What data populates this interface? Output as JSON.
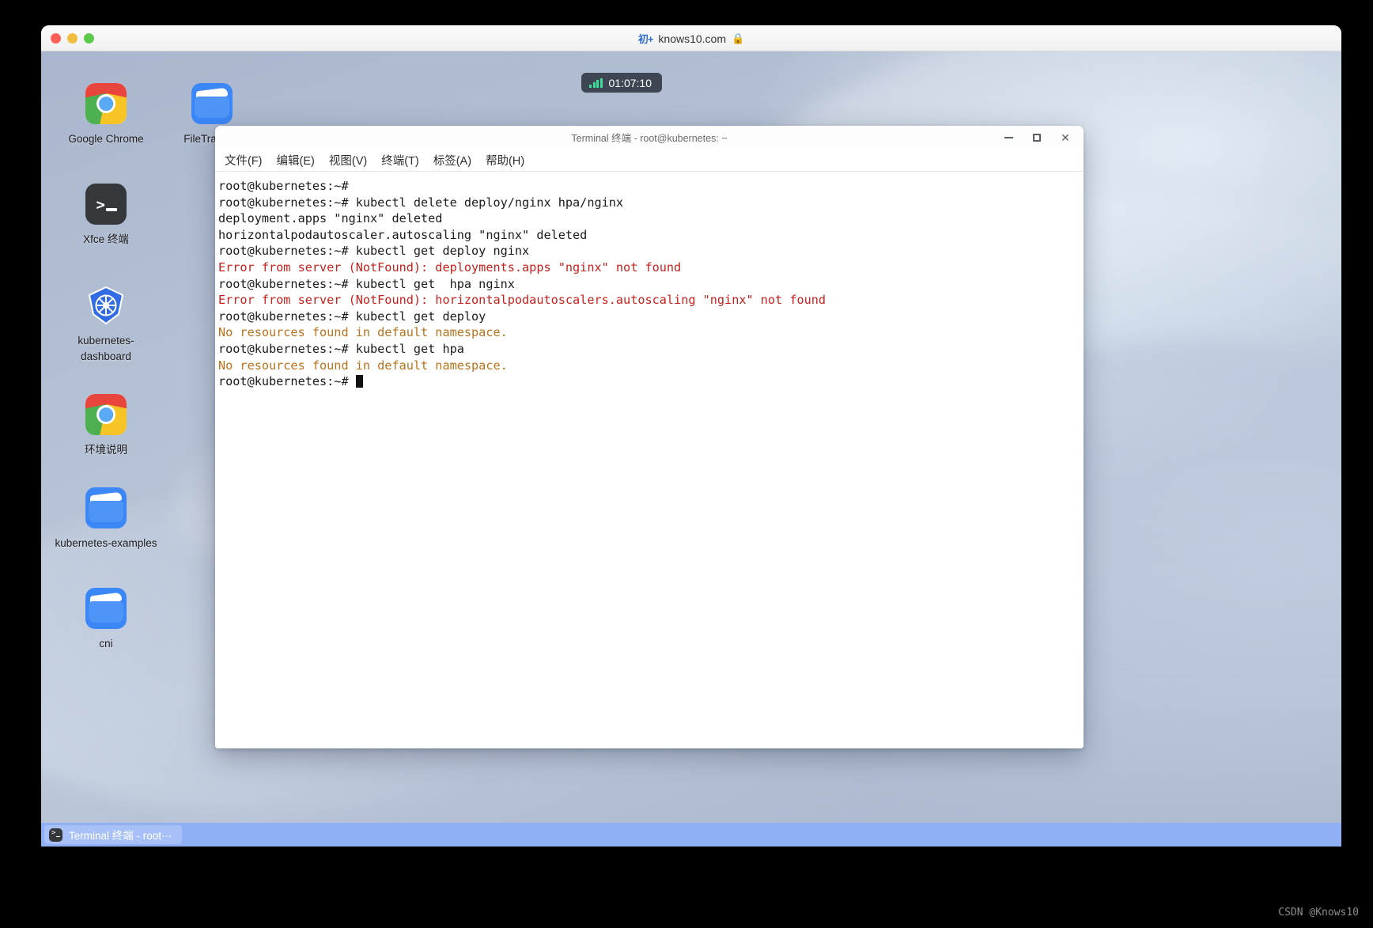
{
  "browser": {
    "address": "knows10.com",
    "lock_icon": "lock-icon",
    "cn_badge": "初+",
    "traffic_lights": [
      "close",
      "minimize",
      "maximize"
    ]
  },
  "status_overlay": {
    "signal_icon": "signal-bars-icon",
    "timer": "01:07:10",
    "signal_color": "#3ddc97"
  },
  "desktop": {
    "icons": [
      {
        "label": "Google Chrome",
        "icon": "google-chrome-icon",
        "col": 0,
        "row": 0
      },
      {
        "label": "FileTransfer",
        "icon": "folder-icon",
        "col": 1,
        "row": 0
      },
      {
        "label": "Xfce 终端",
        "icon": "terminal-icon",
        "col": 0,
        "row": 1
      },
      {
        "label": "kubernetes-dashboard",
        "icon": "kubernetes-icon",
        "col": 0,
        "row": 2
      },
      {
        "label": "环境说明",
        "icon": "google-chrome-icon",
        "col": 0,
        "row": 3
      },
      {
        "label": "kubernetes-examples",
        "icon": "folder-icon",
        "col": 0,
        "row": 4
      },
      {
        "label": "cni",
        "icon": "folder-icon",
        "col": 0,
        "row": 5
      }
    ]
  },
  "terminal": {
    "title": "Terminal 终端 - root@kubernetes: ~",
    "window_buttons": [
      {
        "name": "minimize-button",
        "glyph": "minimize-icon"
      },
      {
        "name": "maximize-button",
        "glyph": "maximize-icon"
      },
      {
        "name": "close-button",
        "glyph": "close-icon"
      }
    ],
    "menu": [
      "文件(F)",
      "编辑(E)",
      "视图(V)",
      "终端(T)",
      "标签(A)",
      "帮助(H)"
    ],
    "colors": {
      "text": "#1b1b1b",
      "error": "#c5211c",
      "warning": "#b8721a",
      "background": "#ffffff"
    },
    "lines": [
      {
        "text": "root@kubernetes:~# ",
        "type": "prompt"
      },
      {
        "text": "root@kubernetes:~# kubectl delete deploy/nginx hpa/nginx",
        "type": "prompt"
      },
      {
        "text": "deployment.apps \"nginx\" deleted",
        "type": "output"
      },
      {
        "text": "horizontalpodautoscaler.autoscaling \"nginx\" deleted",
        "type": "output"
      },
      {
        "text": "root@kubernetes:~# kubectl get deploy nginx",
        "type": "prompt"
      },
      {
        "text": "Error from server (NotFound): deployments.apps \"nginx\" not found",
        "type": "error"
      },
      {
        "text": "root@kubernetes:~# kubectl get  hpa nginx",
        "type": "prompt"
      },
      {
        "text": "Error from server (NotFound): horizontalpodautoscalers.autoscaling \"nginx\" not found",
        "type": "error"
      },
      {
        "text": "root@kubernetes:~# kubectl get deploy",
        "type": "prompt"
      },
      {
        "text": "No resources found in default namespace.",
        "type": "warning"
      },
      {
        "text": "root@kubernetes:~# kubectl get hpa",
        "type": "prompt"
      },
      {
        "text": "No resources found in default namespace.",
        "type": "warning"
      },
      {
        "text": "root@kubernetes:~# ",
        "type": "cursor"
      }
    ]
  },
  "taskbar": {
    "items": [
      {
        "label": "Terminal 终端 - root···",
        "icon": "terminal-icon"
      }
    ]
  },
  "watermark": "CSDN @Knows10"
}
